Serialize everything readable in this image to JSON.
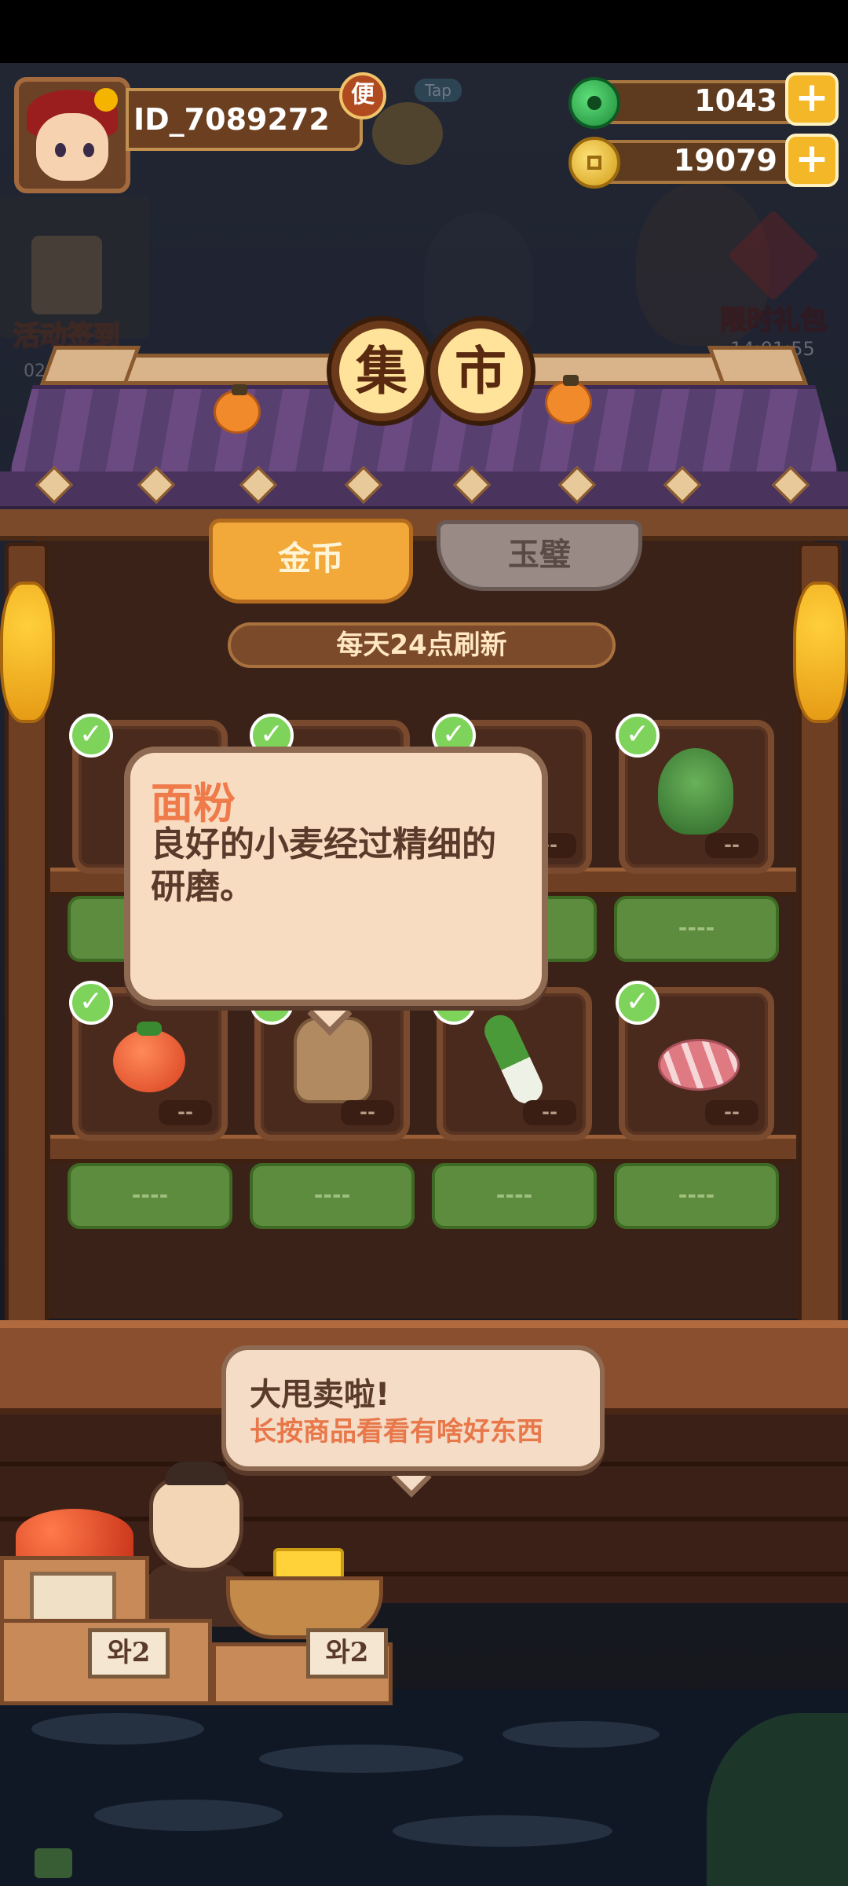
{
  "header": {
    "player_id": "ID_7089272",
    "vip_badge": "便",
    "pet_tap_label": "Tap",
    "jade_amount": "1043",
    "coin_amount": "19079",
    "add_symbol": "+"
  },
  "background": {
    "event_checkin_label": "活动签到",
    "event_checkin_timer": "02",
    "event_gift_label": "限时礼包",
    "event_gift_timer": "14:01:55"
  },
  "market": {
    "title_chars": [
      "集",
      "市"
    ],
    "tabs": [
      {
        "label": "金币",
        "active": true
      },
      {
        "label": "玉璧",
        "active": false
      }
    ],
    "refresh_note": "每天24点刷新",
    "shelves": [
      {
        "items": [
          {
            "item": "flour",
            "checked": true,
            "qty": "--",
            "price": "----"
          },
          {
            "item": "flour",
            "checked": true,
            "qty": "--",
            "price": "----"
          },
          {
            "item": "flour",
            "checked": true,
            "qty": "--",
            "price": "----"
          },
          {
            "item": "greens",
            "checked": true,
            "qty": "--",
            "price": "----"
          }
        ]
      },
      {
        "items": [
          {
            "item": "tomato",
            "checked": true,
            "qty": "--",
            "price": "----"
          },
          {
            "item": "flour",
            "checked": true,
            "qty": "--",
            "price": "----"
          },
          {
            "item": "scallion",
            "checked": true,
            "qty": "--",
            "price": "----"
          },
          {
            "item": "pork",
            "checked": true,
            "qty": "--",
            "price": "----"
          }
        ]
      }
    ]
  },
  "tooltip": {
    "name": "面粉",
    "description": "良好的小麦经过精细的研磨。"
  },
  "vendor": {
    "speech_title": "大甩卖啦!",
    "speech_subtitle": "长按商品看看有啥好东西",
    "price_sign_1": "와2",
    "price_sign_2": "와2"
  },
  "colors": {
    "accent_orange": "#f2a93a",
    "jade_green": "#1f8a3a",
    "coin_gold": "#f3b728",
    "price_button_green": "#5e8c3e",
    "tooltip_name": "#ef7a4a"
  }
}
